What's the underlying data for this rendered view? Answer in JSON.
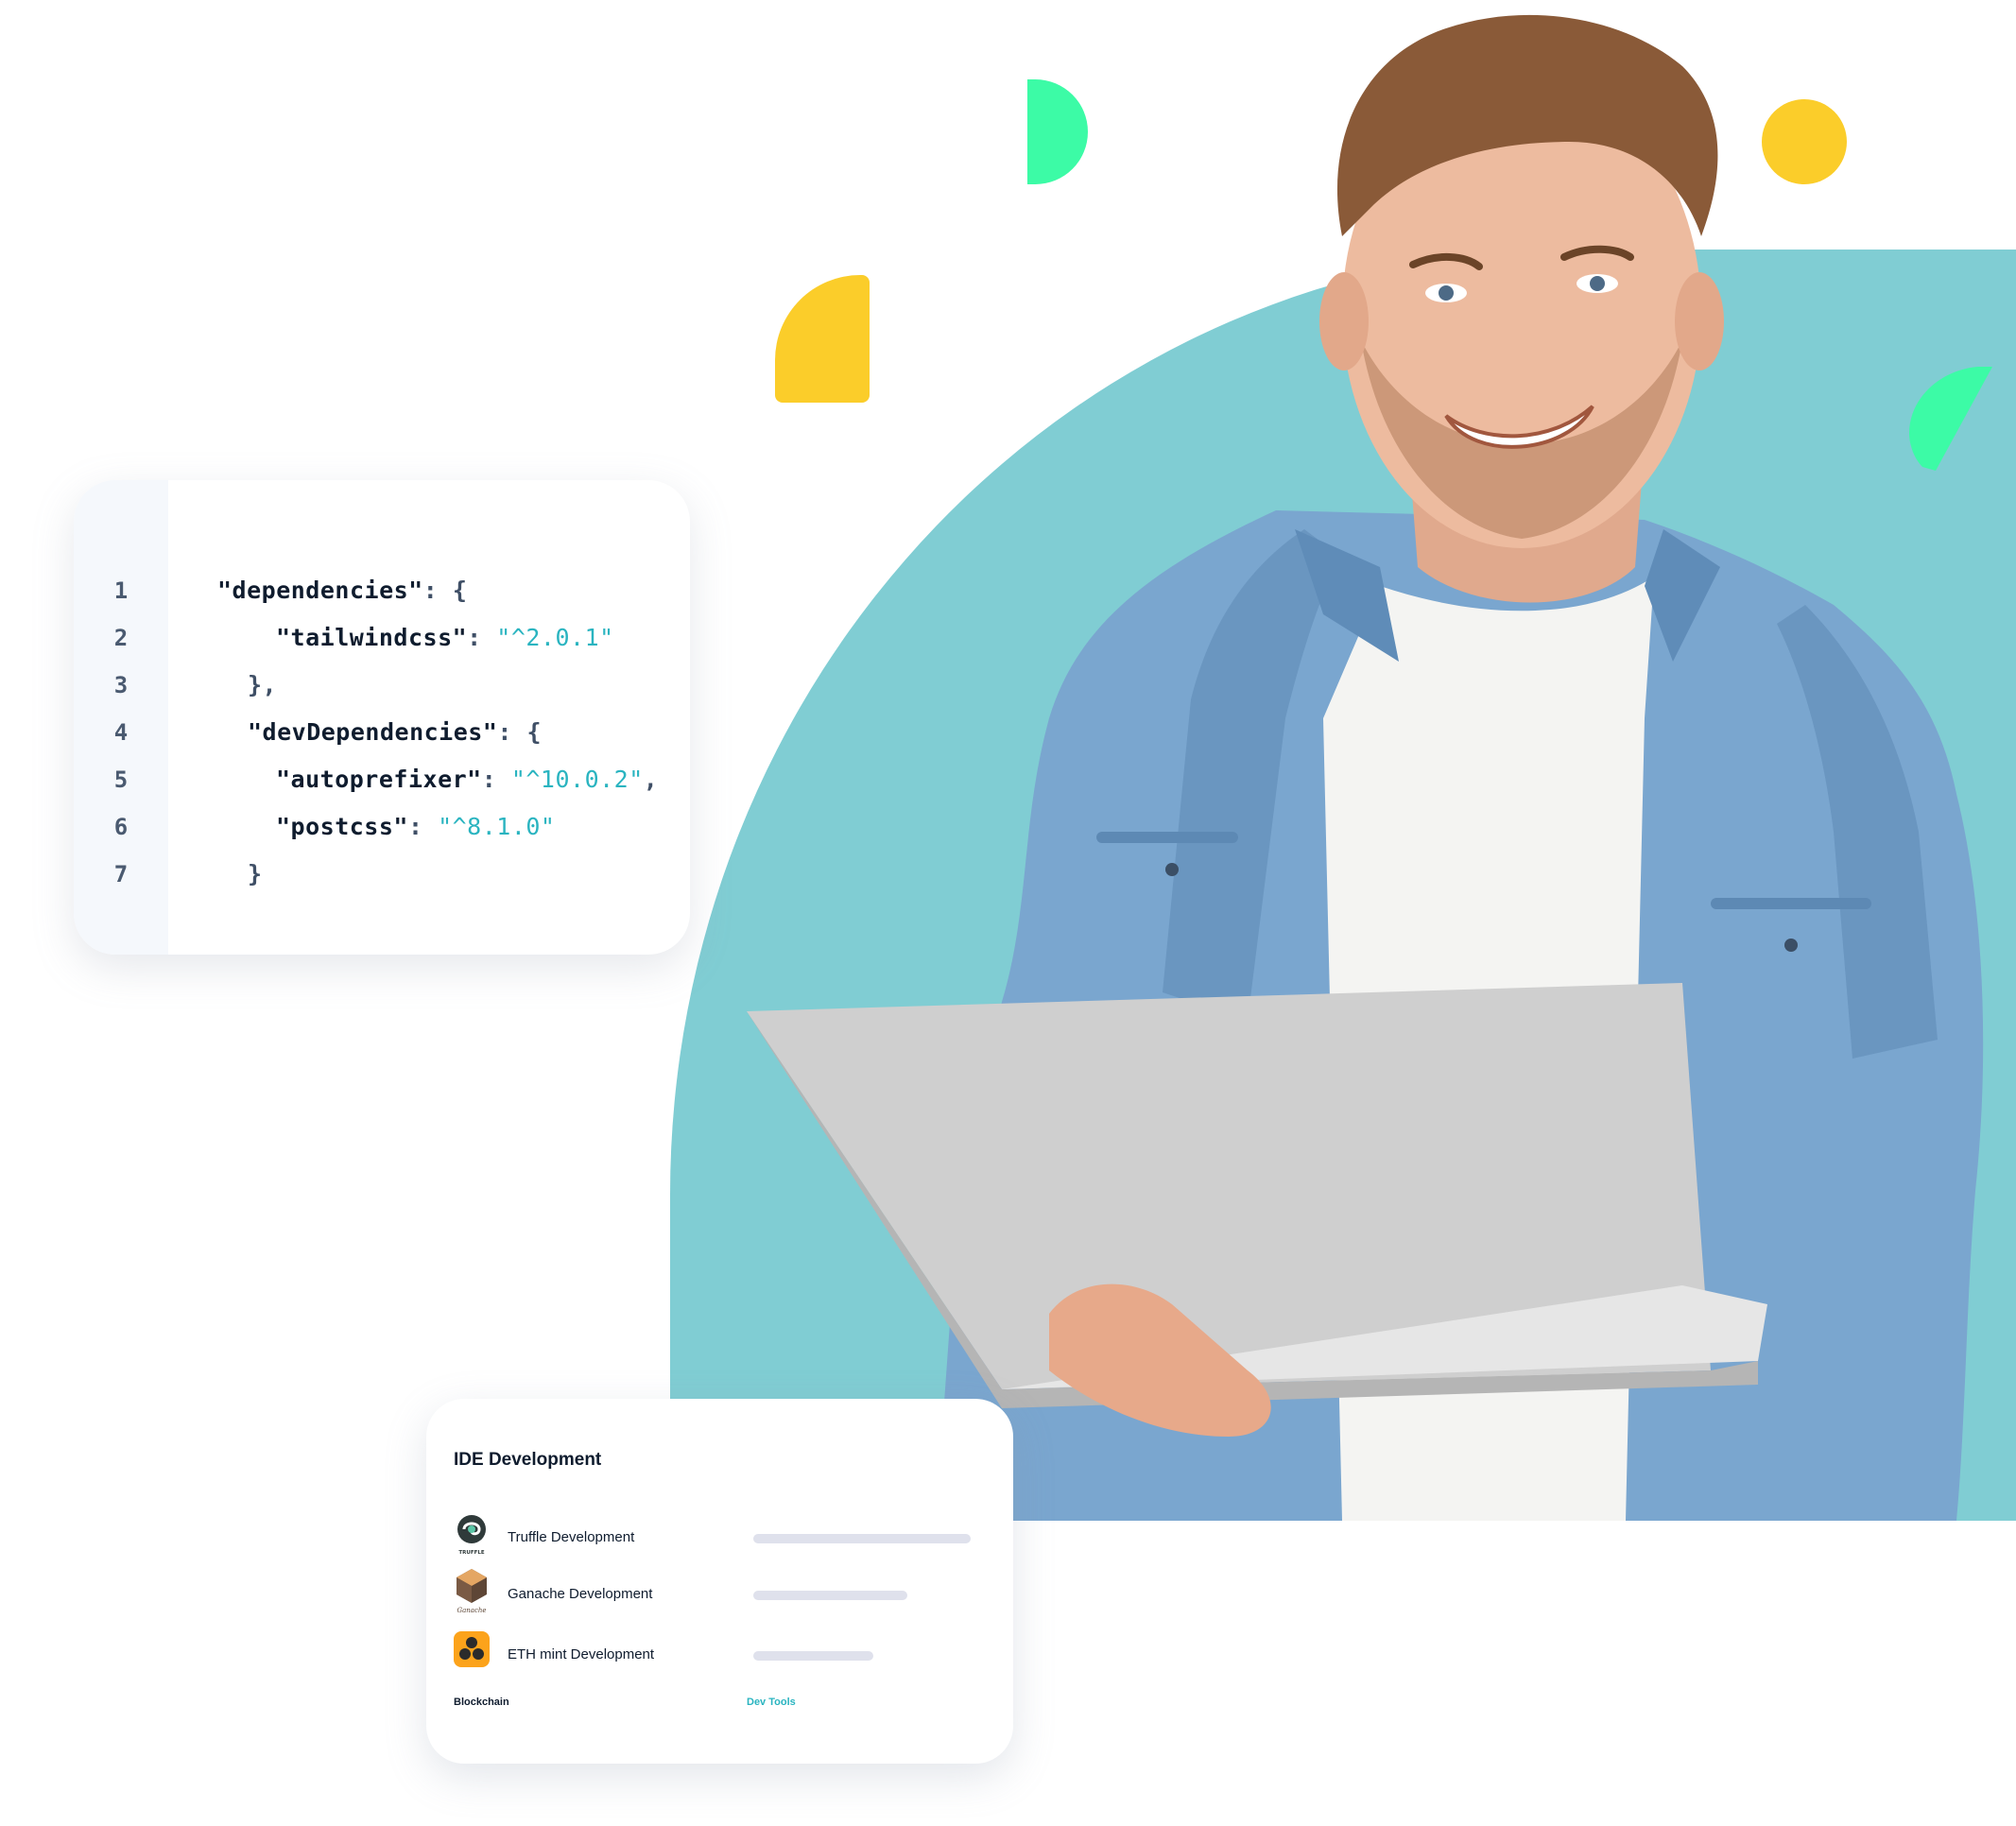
{
  "code": {
    "line_numbers": [
      "1",
      "2",
      "3",
      "4",
      "5",
      "6",
      "7"
    ],
    "lines": [
      {
        "key": "\"dependencies\"",
        "punct": ": {",
        "value": "",
        "tail": ""
      },
      {
        "key": "\"tailwindcss\"",
        "punct": ": ",
        "value": "\"^2.0.1\"",
        "tail": ""
      },
      {
        "key": "",
        "punct": "},",
        "value": "",
        "tail": ""
      },
      {
        "key": "\"devDependencies\"",
        "punct": ": {",
        "value": "",
        "tail": ""
      },
      {
        "key": "\"autoprefixer\"",
        "punct": ": ",
        "value": "\"^10.0.2\"",
        "tail": ","
      },
      {
        "key": "\"postcss\"",
        "punct": ": ",
        "value": "\"^8.1.0\"",
        "tail": ""
      },
      {
        "key": "",
        "punct": "}",
        "value": "",
        "tail": ""
      }
    ]
  },
  "ide_card": {
    "title": "IDE Development",
    "items": [
      {
        "label": "Truffle Development",
        "icon": "truffle-logo-icon",
        "logo_text": "TRUFFLE",
        "progress": 1.0
      },
      {
        "label": "Ganache Development",
        "icon": "ganache-logo-icon",
        "logo_text": "Ganache",
        "progress": 0.71
      },
      {
        "label": "ETH mint Development",
        "icon": "eth-mint-logo-icon",
        "logo_text": "",
        "progress": 0.55
      }
    ],
    "footer_left": "Blockchain",
    "footer_right": "Dev Tools"
  },
  "colors": {
    "teal": "#80cdd3",
    "green": "#3cfba6",
    "yellow": "#fbcd2a",
    "accent_text": "#2ab4c0",
    "bar": "#dfe1ec"
  }
}
